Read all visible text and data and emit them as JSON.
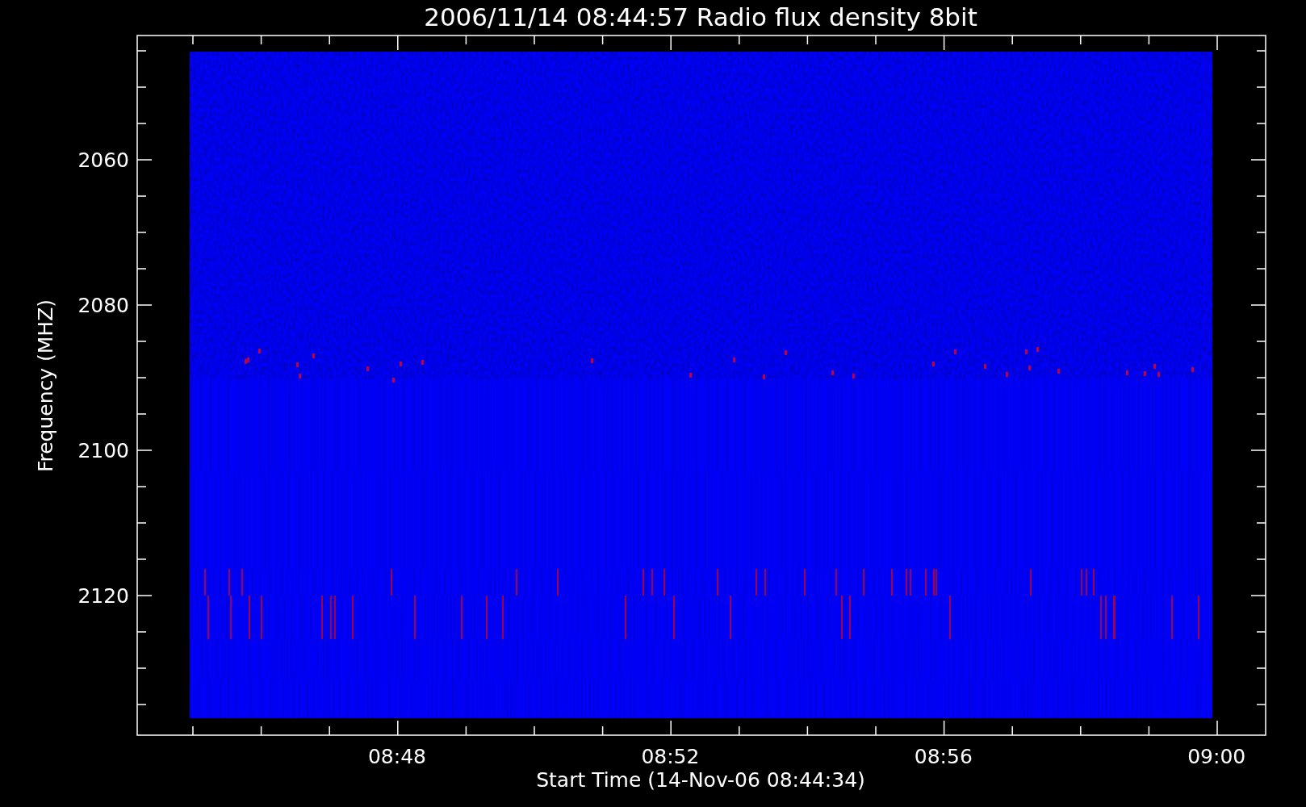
{
  "title": "2006/11/14 08:44:57 Radio flux density 8bit",
  "y_axis": {
    "label": "Frequency (MHZ)",
    "ticks": [
      "2060",
      "2080",
      "2100",
      "2120"
    ]
  },
  "x_axis": {
    "label": "Start Time (14-Nov-06 08:44:34)",
    "ticks": [
      "08:48",
      "08:52",
      "08:56",
      "09:00"
    ]
  }
}
